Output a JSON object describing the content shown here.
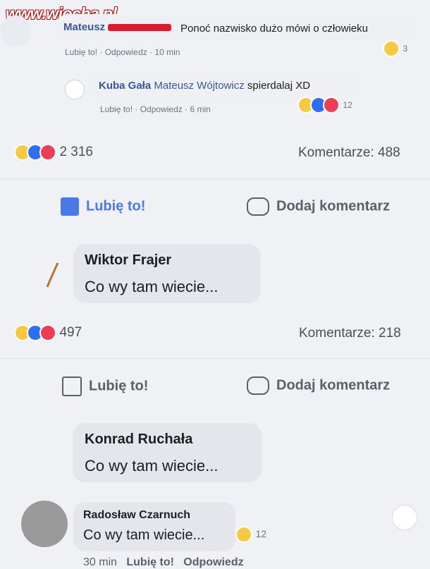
{
  "watermark": "www.wiocha.pl",
  "c1": {
    "name": "Mateusz",
    "text": "Ponoć nazwisko dużo mówi o człowieku",
    "like": "Lubię to!",
    "reply": "Odpowiedz",
    "time": "10 min",
    "reacts": "3"
  },
  "c2": {
    "name": "Kuba Gała",
    "mention": "Mateusz Wójtowicz",
    "text": "spierdalaj XD",
    "like": "Lubię to!",
    "reply": "Odpowiedz",
    "time": "6 min",
    "reacts": "12"
  },
  "post1": {
    "reactions_count": "2 316",
    "comments": "Komentarze: 488",
    "like_label": "Lubię to!",
    "comment_label": "Dodaj komentarz",
    "comment_name": "Wiktor Frajer",
    "comment_text": "Co wy tam wiecie..."
  },
  "post2": {
    "reactions_count": "497",
    "comments": "Komentarze: 218",
    "like_label": "Lubię to!",
    "comment_label": "Dodaj komentarz",
    "comment_name": "Konrad Ruchała",
    "comment_text": "Co wy tam wiecie..."
  },
  "c3": {
    "name": "Radosław Czarnuch",
    "text": "Co wy tam wiecie...",
    "reacts": "12",
    "time": "30 min",
    "like": "Lubię to!",
    "reply": "Odpowiedz"
  },
  "colors": {
    "blue": "#4a78e6",
    "haha": "#f7c943",
    "like": "#2d6ff3",
    "love": "#ee3e56"
  }
}
